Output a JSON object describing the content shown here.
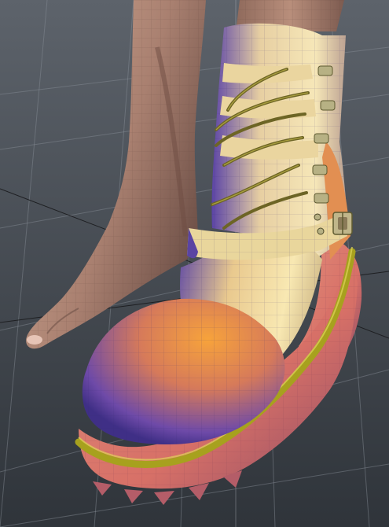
{
  "viewport": {
    "background_top": "#5d636b",
    "background_bottom": "#2f343a",
    "grid_color": "#8a9098",
    "axis_line_color": "#1e1f22",
    "axis_line_light_color": "#bfc4ca"
  },
  "scene": {
    "objects": [
      "leg-left",
      "leg-right",
      "bare-foot",
      "boot"
    ],
    "materials": {
      "skin": "#b48a79",
      "skin_shadow": "#7c5a4e",
      "boot_light": "#f2dfa9",
      "boot_warm": "#f0a54a",
      "boot_shadow": "#5e46a6",
      "sole": "#db7d70",
      "sole_shadow": "#8d4b66",
      "welt": "#a7a11e",
      "lace": "#6d6525",
      "hardware": "#b7b184"
    },
    "buckle_icon": "buckle-icon",
    "lace_hook_icon": "lace-hook-icon"
  }
}
